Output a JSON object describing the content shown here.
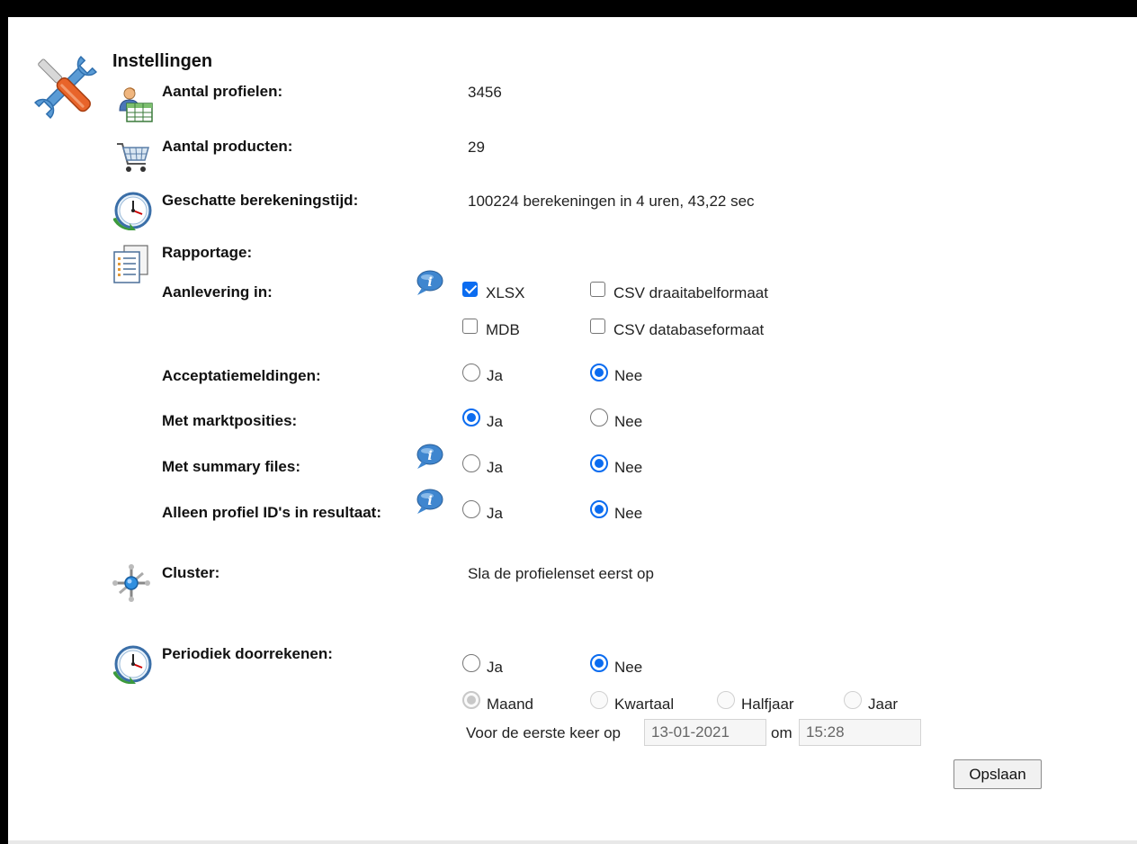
{
  "page": {
    "title": "Instellingen"
  },
  "rows": {
    "profielen": {
      "label": "Aantal profielen:",
      "value": "3456"
    },
    "producten": {
      "label": "Aantal producten:",
      "value": "29"
    },
    "berekeningstijd": {
      "label": "Geschatte berekeningstijd:",
      "value": "100224 berekeningen in 4 uren, 43,22 sec"
    },
    "rapportage": {
      "label": "Rapportage:"
    },
    "aanlevering": {
      "label": "Aanlevering in:",
      "options": [
        {
          "label": "XLSX",
          "checked": true
        },
        {
          "label": "CSV draaitabelformaat",
          "checked": false
        },
        {
          "label": "MDB",
          "checked": false
        },
        {
          "label": "CSV databaseformaat",
          "checked": false
        }
      ]
    },
    "acceptatiemeldingen": {
      "label": "Acceptatiemeldingen:",
      "yes": "Ja",
      "no": "Nee",
      "selected": "Nee"
    },
    "marktposities": {
      "label": "Met marktposities:",
      "yes": "Ja",
      "no": "Nee",
      "selected": "Ja"
    },
    "summary_files": {
      "label": "Met summary files:",
      "yes": "Ja",
      "no": "Nee",
      "selected": "Nee"
    },
    "alleen_profiel_ids": {
      "label": "Alleen profiel ID's in resultaat:",
      "yes": "Ja",
      "no": "Nee",
      "selected": "Nee"
    },
    "cluster": {
      "label": "Cluster:",
      "value": "Sla de profielenset eerst op"
    },
    "periodiek": {
      "label": "Periodiek doorrekenen:",
      "yes": "Ja",
      "no": "Nee",
      "selected": "Nee",
      "frequency": [
        "Maand",
        "Kwartaal",
        "Halfjaar",
        "Jaar"
      ],
      "frequency_selected": "Maand",
      "first_time_label": "Voor de eerste keer op",
      "date": "13-01-2021",
      "om_label": "om",
      "time": "15:28"
    }
  },
  "actions": {
    "save_label": "Opslaan"
  },
  "colors": {
    "accent": "#0b6cf0",
    "border": "#000000"
  },
  "icons": [
    "settings-tools-icon",
    "profiles-icon",
    "shopping-cart-icon",
    "clock-icon",
    "report-icon",
    "info-icon",
    "cluster-icon",
    "schedule-clock-icon"
  ]
}
